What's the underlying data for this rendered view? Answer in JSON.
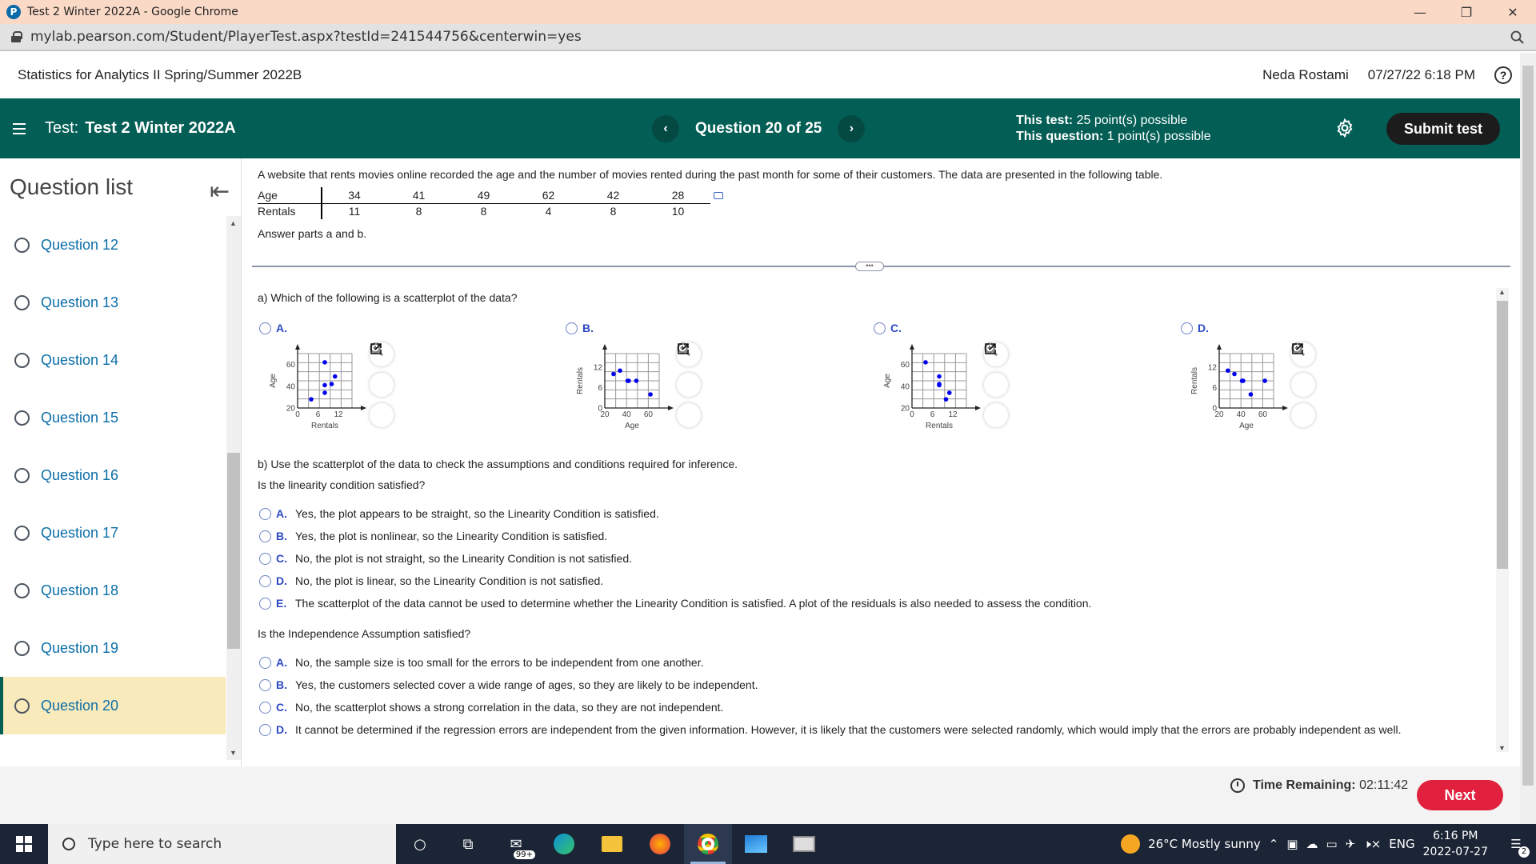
{
  "browser": {
    "window_title": "Test 2 Winter 2022A - Google Chrome",
    "url": "mylab.pearson.com/Student/PlayerTest.aspx?testId=241544756&centerwin=yes",
    "controls": {
      "minimize": "—",
      "restore": "❐",
      "close": "✕"
    },
    "zoom_icon": "magnifier-icon"
  },
  "course": {
    "name": "Statistics for Analytics II Spring/Summer 2022B",
    "user": "Neda Rostami",
    "datetime": "07/27/22 6:18 PM",
    "help": "?"
  },
  "testbar": {
    "label": "Test:",
    "name": "Test 2 Winter 2022A",
    "question_position": "Question 20 of 25",
    "prev": "‹",
    "next": "›",
    "this_test_label": "This test:",
    "this_test_value": "25 point(s) possible",
    "this_question_label": "This question:",
    "this_question_value": "1 point(s) possible",
    "submit": "Submit test",
    "accent": "#035e55"
  },
  "sidebar": {
    "title": "Question list",
    "collapse": "⇤",
    "items": [
      {
        "label": "Question 12",
        "active": false
      },
      {
        "label": "Question 13",
        "active": false
      },
      {
        "label": "Question 14",
        "active": false
      },
      {
        "label": "Question 15",
        "active": false
      },
      {
        "label": "Question 16",
        "active": false
      },
      {
        "label": "Question 17",
        "active": false
      },
      {
        "label": "Question 18",
        "active": false
      },
      {
        "label": "Question 19",
        "active": false
      },
      {
        "label": "Question 20",
        "active": true
      }
    ]
  },
  "question": {
    "prompt": "A website that rents movies online recorded the age and the number of movies rented during the past month for some of their customers. The data are presented in the following table.",
    "table": {
      "rows": [
        {
          "label": "Age",
          "values": [
            "34",
            "41",
            "49",
            "62",
            "42",
            "28"
          ]
        },
        {
          "label": "Rentals",
          "values": [
            "11",
            "8",
            "8",
            "4",
            "8",
            "10"
          ]
        }
      ]
    },
    "answer_parts": "Answer parts a and b.",
    "part_a": "a) Which of the following is a scatterplot of the data?",
    "plot_options": [
      {
        "letter": "A.",
        "xlabel": "Rentals",
        "ylabel": "Age",
        "xticks": [
          "0",
          "6",
          "12"
        ],
        "yticks": [
          "20",
          "40",
          "60"
        ]
      },
      {
        "letter": "B.",
        "xlabel": "Age",
        "ylabel": "Rentals",
        "xticks": [
          "20",
          "40",
          "60"
        ],
        "yticks": [
          "0",
          "6",
          "12"
        ]
      },
      {
        "letter": "C.",
        "xlabel": "Rentals",
        "ylabel": "Age",
        "xticks": [
          "0",
          "6",
          "12"
        ],
        "yticks": [
          "20",
          "40",
          "60"
        ]
      },
      {
        "letter": "D.",
        "xlabel": "Age",
        "ylabel": "Rentals",
        "xticks": [
          "20",
          "40",
          "60"
        ],
        "yticks": [
          "0",
          "6",
          "12"
        ]
      }
    ],
    "part_b": "b) Use the scatterplot of the data to check the assumptions and conditions required for inference.",
    "linearity_q": "Is the linearity condition satisfied?",
    "linearity_choices": [
      {
        "letter": "A.",
        "text": "Yes, the plot appears to be straight, so the Linearity Condition is satisfied."
      },
      {
        "letter": "B.",
        "text": "Yes, the plot is nonlinear, so the Linearity Condition is satisfied."
      },
      {
        "letter": "C.",
        "text": "No, the plot is not straight, so the Linearity Condition is not satisfied."
      },
      {
        "letter": "D.",
        "text": "No, the plot is linear, so the Linearity Condition is not satisfied."
      },
      {
        "letter": "E.",
        "text": "The scatterplot of the data cannot be used to determine whether the Linearity Condition is satisfied. A plot of the residuals is also needed to assess the condition."
      }
    ],
    "independence_q": "Is the Independence Assumption satisfied?",
    "independence_choices": [
      {
        "letter": "A.",
        "text": "No, the sample size is too small for the errors to be independent from one another."
      },
      {
        "letter": "B.",
        "text": "Yes, the customers selected cover a wide range of ages, so they are likely to be independent."
      },
      {
        "letter": "C.",
        "text": "No, the scatterplot shows a strong correlation in the data, so they are not independent."
      },
      {
        "letter": "D.",
        "text": "It cannot be determined if the regression errors are independent from the given information. However, it is likely that the customers were selected randomly, which would imply that the errors are probably independent as well."
      }
    ]
  },
  "chart_data": [
    {
      "type": "scatter",
      "title": "Option A",
      "xlabel": "Rentals",
      "ylabel": "Age",
      "xlim": [
        0,
        16
      ],
      "ylim": [
        20,
        70
      ],
      "x": [
        8,
        11,
        8,
        8,
        10,
        4
      ],
      "y": [
        62,
        49,
        41,
        34,
        42,
        28
      ],
      "point_color": "#0000ee"
    },
    {
      "type": "scatter",
      "title": "Option B",
      "xlabel": "Age",
      "ylabel": "Rentals",
      "xlim": [
        20,
        70
      ],
      "ylim": [
        0,
        16
      ],
      "x": [
        34,
        41,
        49,
        62,
        42,
        28
      ],
      "y": [
        11,
        8,
        8,
        4,
        8,
        10
      ],
      "point_color": "#0000ee"
    },
    {
      "type": "scatter",
      "title": "Option C",
      "xlabel": "Rentals",
      "ylabel": "Age",
      "xlim": [
        0,
        16
      ],
      "ylim": [
        20,
        70
      ],
      "x": [
        4,
        8,
        8,
        8,
        11,
        10
      ],
      "y": [
        62,
        49,
        42,
        41,
        34,
        28
      ],
      "point_color": "#0000ee"
    },
    {
      "type": "scatter",
      "title": "Option D",
      "xlabel": "Age",
      "ylabel": "Rentals",
      "xlim": [
        20,
        70
      ],
      "ylim": [
        0,
        16
      ],
      "x": [
        28,
        34,
        41,
        42,
        49,
        62
      ],
      "y": [
        11,
        10,
        8,
        8,
        4,
        8
      ],
      "point_color": "#0000ee"
    }
  ],
  "footer": {
    "time_label": "Time Remaining:",
    "time_value": "02:11:42",
    "next": "Next"
  },
  "taskbar": {
    "search_placeholder": "Type here to search",
    "mail_badge": "99+",
    "weather": "26°C  Mostly sunny",
    "lang": "ENG",
    "time": "6:16 PM",
    "date": "2022-07-27",
    "notifications": "2"
  }
}
